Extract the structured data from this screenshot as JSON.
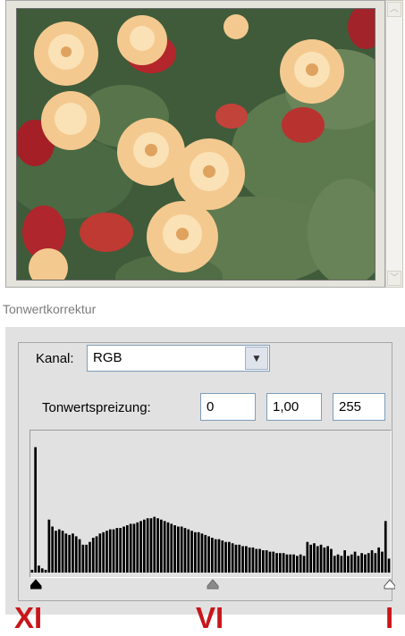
{
  "dialog": {
    "title": "Tonwertkorrektur",
    "channel_label": "Kanal:",
    "channel_value": "RGB",
    "input_levels_label": "Tonwertspreizung:",
    "input_levels": {
      "black": "0",
      "gamma": "1,00",
      "white": "255"
    }
  },
  "histogram": {
    "bars": [
      0.02,
      0.9,
      0.05,
      0.03,
      0.02,
      0.38,
      0.33,
      0.3,
      0.31,
      0.3,
      0.28,
      0.27,
      0.28,
      0.26,
      0.24,
      0.2,
      0.2,
      0.22,
      0.25,
      0.26,
      0.28,
      0.29,
      0.3,
      0.31,
      0.31,
      0.32,
      0.32,
      0.33,
      0.34,
      0.35,
      0.35,
      0.36,
      0.37,
      0.38,
      0.39,
      0.39,
      0.4,
      0.39,
      0.38,
      0.37,
      0.36,
      0.35,
      0.34,
      0.33,
      0.33,
      0.32,
      0.31,
      0.3,
      0.29,
      0.29,
      0.28,
      0.27,
      0.26,
      0.25,
      0.24,
      0.24,
      0.23,
      0.22,
      0.22,
      0.21,
      0.2,
      0.2,
      0.19,
      0.19,
      0.18,
      0.18,
      0.17,
      0.17,
      0.16,
      0.16,
      0.15,
      0.15,
      0.14,
      0.14,
      0.14,
      0.13,
      0.13,
      0.13,
      0.12,
      0.13,
      0.12,
      0.22,
      0.2,
      0.21,
      0.19,
      0.2,
      0.18,
      0.19,
      0.17,
      0.12,
      0.13,
      0.12,
      0.16,
      0.12,
      0.13,
      0.15,
      0.12,
      0.14,
      0.13,
      0.14,
      0.16,
      0.14,
      0.18,
      0.15,
      0.37,
      0.1
    ]
  },
  "slider": {
    "black_point": 0,
    "gamma_point": 0.5,
    "white_point": 1
  },
  "annotations": {
    "left": "XI",
    "middle": "VI",
    "right": "I"
  },
  "colors": {
    "annotation": "#c8161b",
    "histogram": "#000000",
    "panel": "#e1e1e1"
  }
}
